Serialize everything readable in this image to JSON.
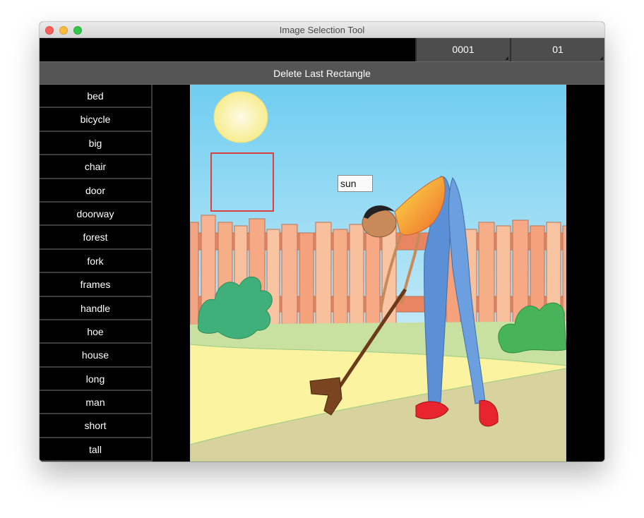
{
  "window": {
    "title": "Image Selection Tool"
  },
  "topbar": {
    "field_a": "0001",
    "field_b": "01"
  },
  "toolbar": {
    "delete_label": "Delete Last Rectangle"
  },
  "words": [
    "bed",
    "bicycle",
    "big",
    "chair",
    "door",
    "doorway",
    "forest",
    "fork",
    "frames",
    "handle",
    "hoe",
    "house",
    "long",
    "man",
    "short",
    "tall"
  ],
  "annotation": {
    "label": "sun"
  },
  "colors": {
    "accent_selection": "#d94040",
    "panel": "#555555",
    "background": "#000000"
  },
  "icons": [
    "close-icon",
    "minimize-icon",
    "maximize-icon"
  ]
}
